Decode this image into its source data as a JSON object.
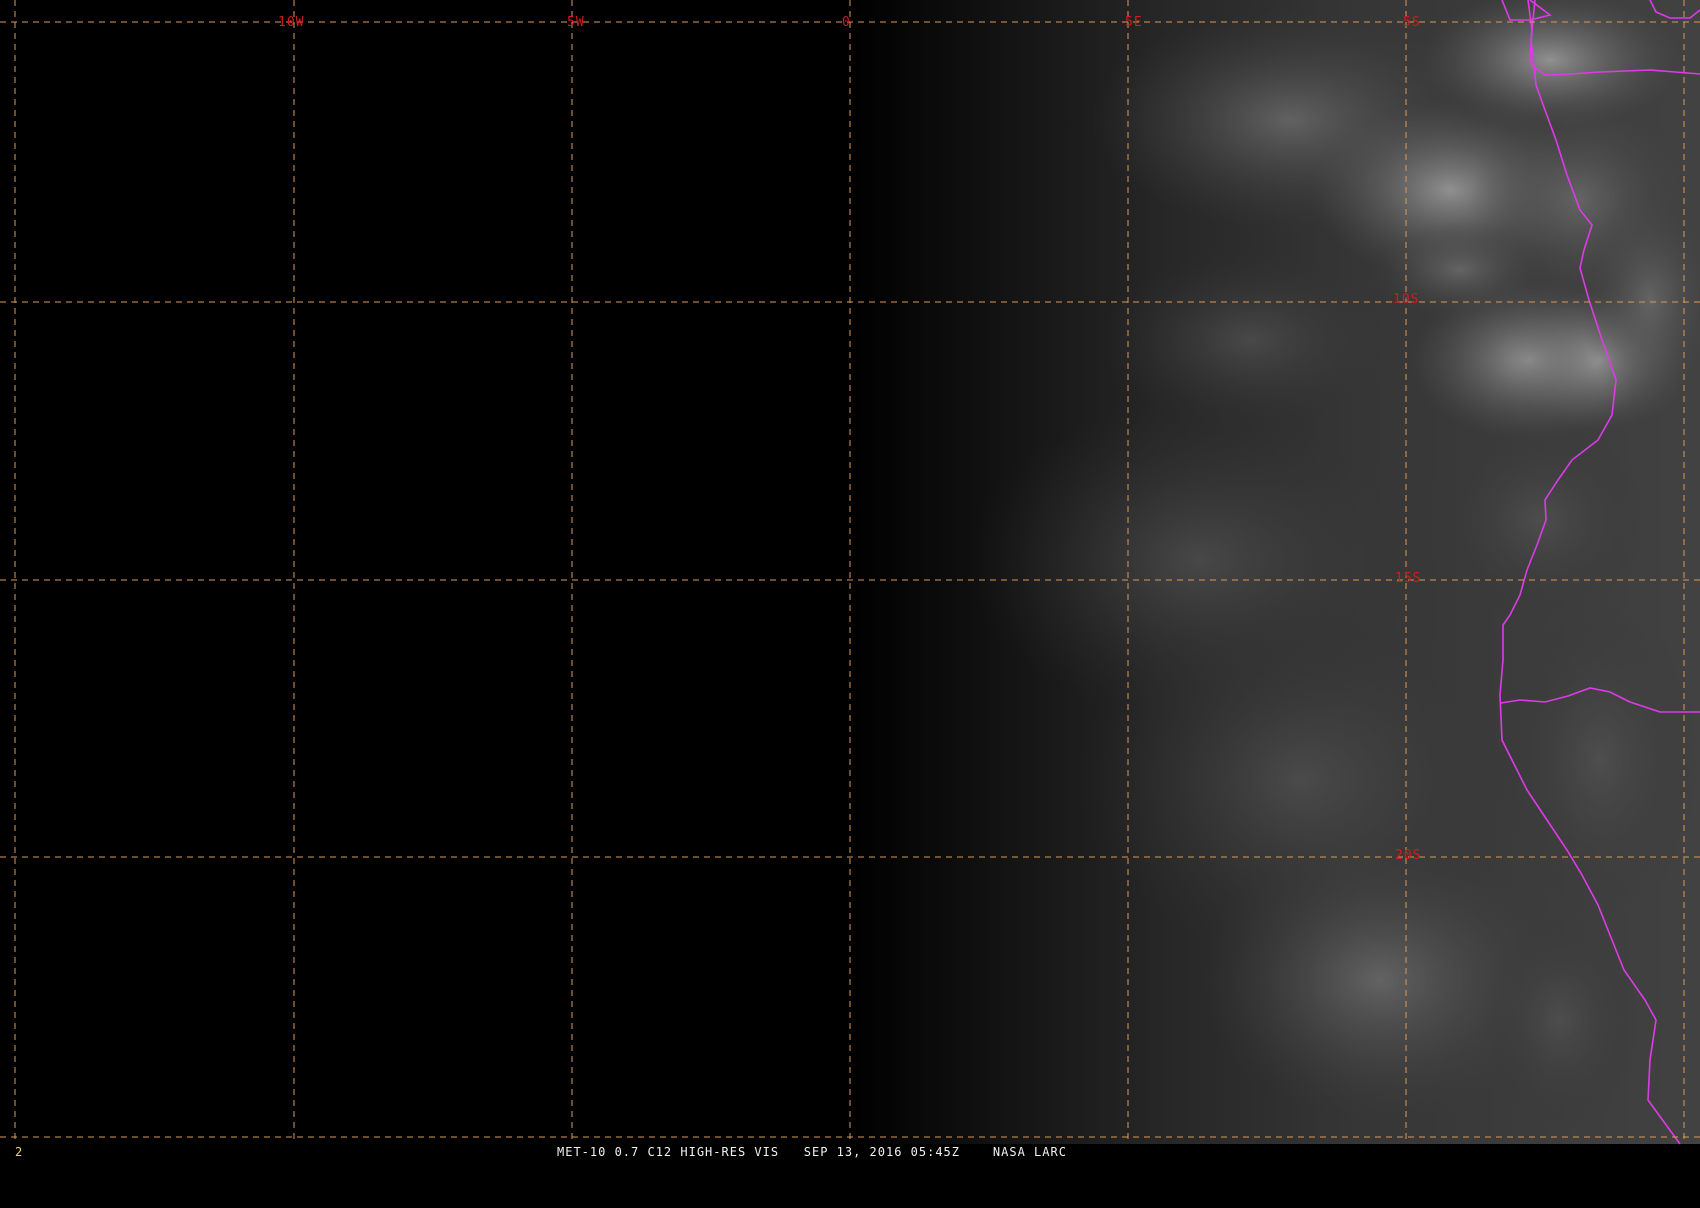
{
  "map": {
    "longitude_labels": [
      "10W",
      "5W",
      "0",
      "5E",
      "5S"
    ],
    "latitude_labels": [
      "10S",
      "15S",
      "20S"
    ],
    "colors": {
      "grid": "#d79a5a",
      "label": "#cc1e1e",
      "coastline": "#dc3ce6"
    }
  },
  "status_bar": {
    "frame_number": "2",
    "caption": "MET-10 0.7 C12 HIGH-RES VIS   SEP 13, 2016 05:45Z    NASA LARC"
  }
}
